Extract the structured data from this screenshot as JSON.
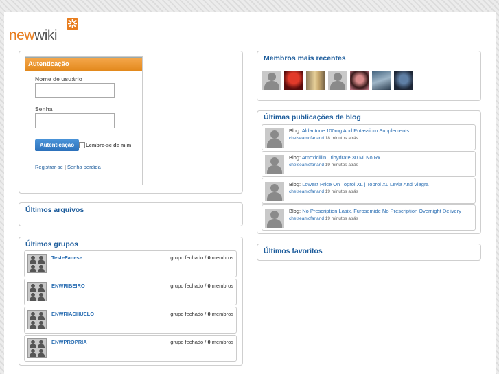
{
  "logo": {
    "part1": "new",
    "part2": "wiki"
  },
  "auth": {
    "title": "Autenticação",
    "username_label": "Nome de usuário",
    "password_label": "Senha",
    "submit": "Autenticação",
    "remember": "Lembre-se de mim",
    "register": "Registrar-se",
    "separator": "|",
    "lost_password": "Senha perdida"
  },
  "files": {
    "title": "Últimos arquivos"
  },
  "groups": {
    "title": "Últimos grupos",
    "items": [
      {
        "name": "TesteFanese",
        "status": "grupo fechado / ",
        "count": "0",
        "unit": " membros"
      },
      {
        "name": "ENWRIBEIRO",
        "status": "grupo fechado / ",
        "count": "0",
        "unit": " membros"
      },
      {
        "name": "ENWRIACHUELO",
        "status": "grupo fechado / ",
        "count": "0",
        "unit": " membros"
      },
      {
        "name": "ENWPROPRIA",
        "status": "grupo fechado / ",
        "count": "0",
        "unit": " membros"
      }
    ]
  },
  "members": {
    "title": "Membros mais recentes",
    "avatars": [
      "default-avatar",
      "red-photo",
      "blonde-photo",
      "default-avatar",
      "pink-photo",
      "blue-photo",
      "dark-photo"
    ]
  },
  "blog": {
    "title": "Últimas publicações de blog",
    "posts": [
      {
        "prefix": "Blog: ",
        "title": "Aldactone 100mg And Potassium Supplements",
        "user": "chelseamcfarland",
        "time": " 18 minutos atrás"
      },
      {
        "prefix": "Blog: ",
        "title": "Amoxicillin Trihydrate 30 Ml No Rx",
        "user": "chelseamcfarland",
        "time": " 19 minutos atrás"
      },
      {
        "prefix": "Blog: ",
        "title": "Lowest Price On Toprol XL | Toprol XL Levia And Viagra",
        "user": "chelseamcfarland",
        "time": " 19 minutos atrás"
      },
      {
        "prefix": "Blog: ",
        "title": "No Prescription Lasix, Furosemide No Prescription Overnight Delivery",
        "user": "chelseamcfarland",
        "time": " 19 minutos atrás"
      }
    ]
  },
  "favorites": {
    "title": "Últimos favoritos"
  },
  "colors": {
    "link": "#1e5d9c",
    "accent": "#e87d1e",
    "button": "#2c71bb"
  }
}
